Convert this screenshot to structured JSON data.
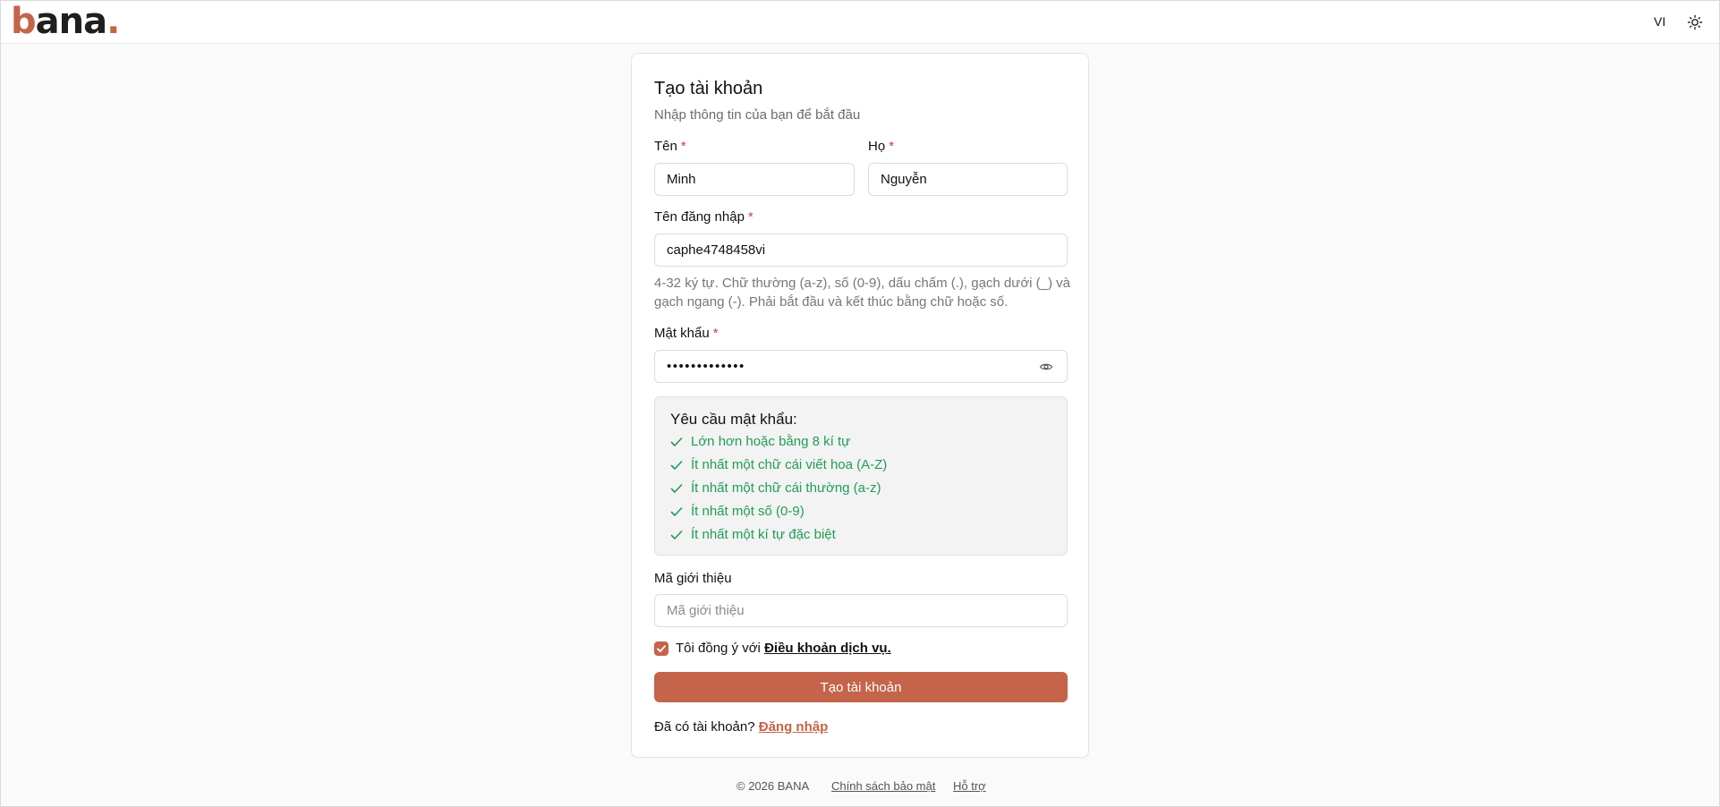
{
  "header": {
    "logo_text": "bana.",
    "language": "VI",
    "theme_icon": "sun-icon"
  },
  "form": {
    "title": "Tạo tài khoản",
    "subtitle": "Nhập thông tin của bạn để bắt đầu",
    "required_mark": "*",
    "first_name": {
      "label": "Tên",
      "value": "Minh"
    },
    "last_name": {
      "label": "Họ",
      "value": "Nguyễn"
    },
    "username": {
      "label": "Tên đăng nhập",
      "value": "caphe4748458vi",
      "hint": "4-32 ký tự. Chữ thường (a-z), số (0-9), dấu chấm (.), gạch dưới (_) và gạch ngang (-). Phải bắt đầu và kết thúc bằng chữ hoặc số."
    },
    "password": {
      "label": "Mật khẩu",
      "masked_value": "•••••••••••••",
      "toggle_icon": "eye-icon"
    },
    "requirements": {
      "title": "Yêu cầu mật khẩu:",
      "color": "#1f9d55",
      "items": [
        {
          "text": "Lớn hơn hoặc bằng 8 kí tự",
          "met": true
        },
        {
          "text": "Ít nhất một chữ cái viết hoa (A-Z)",
          "met": true
        },
        {
          "text": "Ít nhất một chữ cái thường (a-z)",
          "met": true
        },
        {
          "text": "Ít nhất một số (0-9)",
          "met": true
        },
        {
          "text": "Ít nhất một kí tự đặc biệt",
          "met": true
        }
      ]
    },
    "referral": {
      "label": "Mã giới thiệu",
      "placeholder": "Mã giới thiệu",
      "value": ""
    },
    "terms": {
      "checked": true,
      "prefix": "Tôi đồng ý với",
      "link": "Điều khoản dịch vụ."
    },
    "submit_label": "Tạo tài khoản",
    "login_prompt": "Đã có tài khoản?",
    "login_link": "Đăng nhập"
  },
  "footer": {
    "copyright": "© 2026 BANA",
    "privacy": "Chính sách bảo mật",
    "support": "Hỗ trợ"
  },
  "colors": {
    "accent": "#c4644a",
    "success": "#1f9d55",
    "required": "#d33b3b"
  }
}
